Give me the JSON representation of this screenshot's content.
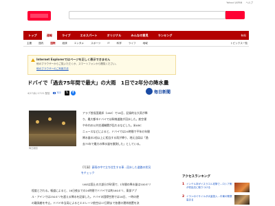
{
  "header": {
    "links": [
      "Yahoo! JAPAN",
      "ヘルプ"
    ]
  },
  "nav": {
    "items": [
      "トップ",
      "速報",
      "ライブ",
      "エキスパート",
      "オリジナル",
      "みんなの意見",
      "ランキング"
    ],
    "active_index": 1,
    "right": "有料"
  },
  "subnav": {
    "items": [
      "主要",
      "国内",
      "国際",
      "経済",
      "エンタメ",
      "スポーツ",
      "IT",
      "科学",
      "ライフ",
      "地域"
    ],
    "active_index": 2,
    "right": "トピックス一覧"
  },
  "notice": {
    "title": "Internet Explorerではページを正しく表示できません",
    "body": "他のブラウザーからご覧いただくか、スマートフォンから閲覧ください。",
    "link": "他のブラウザーのご利用方法"
  },
  "article": {
    "title": "ドバイで「過去75年間で最大」の大雨　1日で2年分の降水量",
    "date": "4/17(水) 17:21 配信",
    "comments": "322",
    "publisher": "毎日新聞",
    "photo_caption": "毎日新聞",
    "body_lines": [
      "アラブ首長国連邦（UAE）で16日、記録的な大雨が降",
      "り、最大都市ドバイでは幹線道路が冠水した。航空便",
      "や市内の公共交通機関が乱れるなどした。米ABC",
      "ニュースなどによると、ドバイでは24時間で平年の年間",
      "降水量の2倍以上に相当する雨が降り、地元当局は「過",
      "去75年で最大の降水量を観測した」としている。"
    ],
    "caption_tag": "【写真】",
    "caption_line1": "豪雨の中で立ち往生する車…冠水した道路の状況",
    "caption_line2": "をチェック",
    "para2_lines": [
      "UAEは国土の大部分が砂漠で、1年間の降水量は100ミリ",
      "程度とされる。報道によると、16日夜までの24時間でドバイでは約160ミリ、東部アブ",
      "ル・アインでは250ミリを超える降水を記録した。ドバイの国際空港では16日、一時の便",
      "の離発着を中止。ドバイ市当局によるとエミレーツ航空は17日朝まで各便の運休措置を決",
      "めるなどの混乱が起きたとされる。",
      "UAE当局では70年の気候が記録を更新したとの見方も示す。"
    ]
  },
  "ranking": {
    "title": "アクセスランキング",
    "items": [
      {
        "rank": "1",
        "text": "インテル本がイスラエル攻撃で…ロシア側が初反応に取りつける"
      },
      {
        "rank": "2",
        "text": "イランのミサイルが大量投入…中東の緊張高まる"
      }
    ]
  },
  "colors": {
    "brand": "#ff0033",
    "nav": "#b30000",
    "link": "#1a56c7"
  }
}
